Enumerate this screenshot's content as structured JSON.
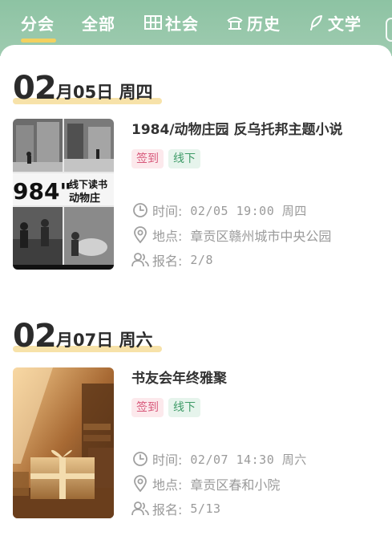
{
  "tabs": [
    {
      "label": "分会",
      "icon": "",
      "active": true
    },
    {
      "label": "全部",
      "icon": "",
      "active": false
    },
    {
      "label": "社会",
      "icon": "building-icon",
      "active": false
    },
    {
      "label": "历史",
      "icon": "temple-icon",
      "active": false
    },
    {
      "label": "文学",
      "icon": "feather-icon",
      "active": false
    }
  ],
  "colors": {
    "header_green": "#8dc3a3",
    "accent_yellow": "#f3d15f",
    "tag_red": "#d7587a",
    "tag_green": "#3f9b68"
  },
  "groups": [
    {
      "date_month": "02",
      "date_rest": "月05日 周四",
      "event": {
        "title": "1984/动物庄园 反乌托邦主题小说",
        "poster_text": {
          "big": "984\"",
          "line1": "线下读书",
          "line2": "动物庄"
        },
        "tags": {
          "checkin": "签到",
          "offline": "线下"
        },
        "time_label": "时间:",
        "time_value": "02/05 19:00 周四",
        "place_label": "地点:",
        "place_value": "章贡区赣州城市中央公园",
        "signup_label": "报名:",
        "signup_value": "2/8"
      }
    },
    {
      "date_month": "02",
      "date_rest": "月07日 周六",
      "event": {
        "title": "书友会年终雅聚",
        "tags": {
          "checkin": "签到",
          "offline": "线下"
        },
        "time_label": "时间:",
        "time_value": "02/07 14:30 周六",
        "place_label": "地点:",
        "place_value": "章贡区春和小院",
        "signup_label": "报名:",
        "signup_value": "5/13"
      }
    }
  ]
}
